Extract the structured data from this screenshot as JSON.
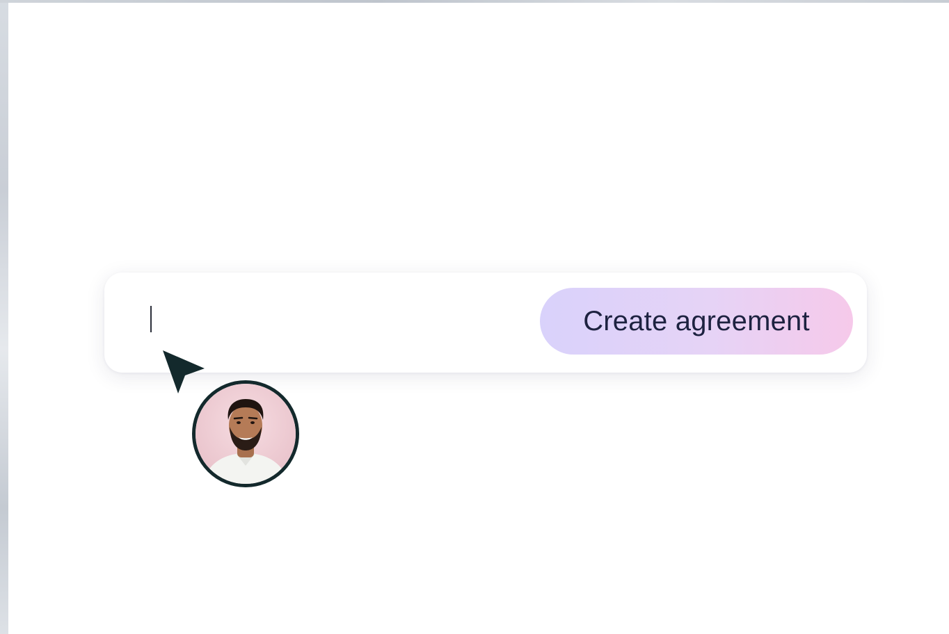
{
  "composer": {
    "input_value": "",
    "create_button_label": "Create agreement"
  },
  "cursor": {
    "icon": "pointer-arrow-icon",
    "color": "#13292c"
  },
  "avatar": {
    "icon": "user-avatar",
    "ring_color": "#13292c",
    "background_color": "#f2cfd6"
  },
  "colors": {
    "button_gradient_start": "#d9d2fb",
    "button_gradient_end": "#f6c9ea",
    "button_text": "#1d2240"
  }
}
